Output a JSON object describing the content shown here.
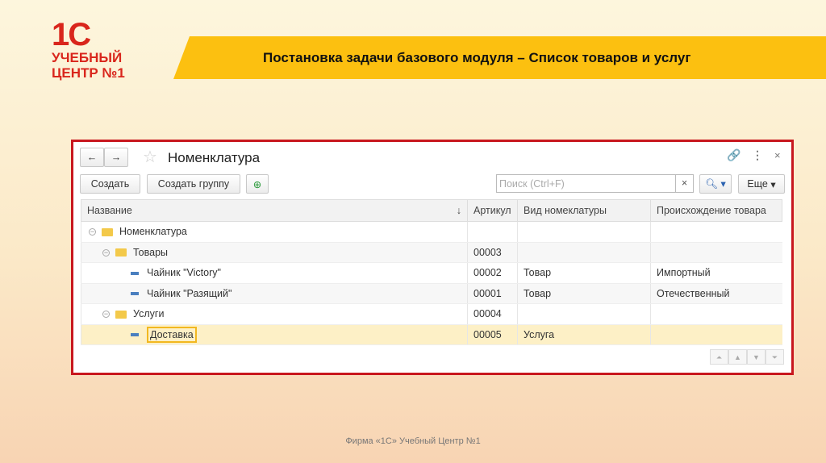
{
  "logo": {
    "line1": "1С",
    "line2": "УЧЕБНЫЙ",
    "line3": "ЦЕНТР №1"
  },
  "banner": {
    "title": "Постановка задачи базового модуля – Список товаров и услуг"
  },
  "window": {
    "title": "Номенклатура",
    "create": "Создать",
    "create_group": "Создать группу",
    "search_placeholder": "Поиск (Ctrl+F)",
    "more": "Еще"
  },
  "table": {
    "headers": [
      "Название",
      "Артикул",
      "Вид номеклатуры",
      "Происхождение товара"
    ],
    "rows": [
      {
        "name": "Номенклатура",
        "code": "",
        "kind": "",
        "origin": ""
      },
      {
        "name": "Товары",
        "code": "00003",
        "kind": "",
        "origin": ""
      },
      {
        "name": "Чайник \"Victory\"",
        "code": "00002",
        "kind": "Товар",
        "origin": "Импортный"
      },
      {
        "name": "Чайник \"Разящий\"",
        "code": "00001",
        "kind": "Товар",
        "origin": "Отечественный"
      },
      {
        "name": "Услуги",
        "code": "00004",
        "kind": "",
        "origin": ""
      },
      {
        "name": "Доставка",
        "code": "00005",
        "kind": "Услуга",
        "origin": ""
      }
    ]
  },
  "footer": "Фирма «1С» Учебный Центр №1"
}
